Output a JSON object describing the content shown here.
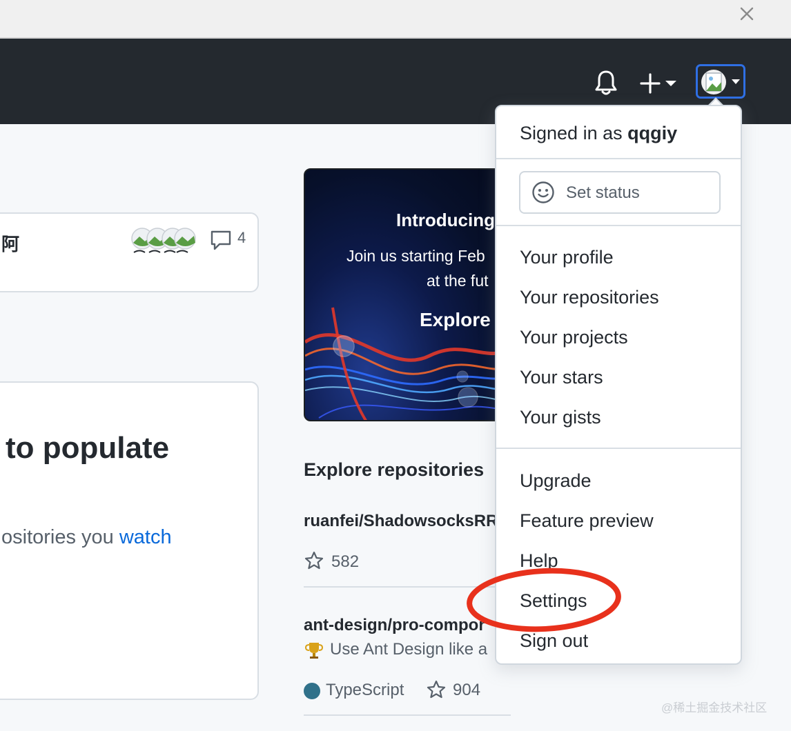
{
  "header": {
    "notifications_icon": "bell-icon",
    "create_icon": "plus-icon",
    "avatar_icon": "avatar-placeholder-icon"
  },
  "feed": {
    "card1_text": "阿",
    "card1_comment_count": "4",
    "card2_heading": "to populate",
    "card2_watch_prefix": "ositories you ",
    "card2_watch_link": "watch"
  },
  "promo": {
    "title": "Introducing",
    "subtitle_line1": "Join us starting Feb",
    "subtitle_line2": "at the fut",
    "cta": "Explore"
  },
  "explore": {
    "heading": "Explore repositories",
    "repos": [
      {
        "name": "ruanfei/ShadowsocksRR",
        "stars": "582"
      },
      {
        "name": "ant-design/pro-compor",
        "description": "Use Ant Design like a",
        "language": "TypeScript",
        "language_color": "#30718a",
        "stars": "904"
      }
    ]
  },
  "dropdown": {
    "signed_in_prefix": "Signed in as ",
    "username": "qqgiy",
    "set_status": "Set status",
    "items": [
      {
        "label": "Your profile"
      },
      {
        "label": "Your repositories"
      },
      {
        "label": "Your projects"
      },
      {
        "label": "Your stars"
      },
      {
        "label": "Your gists"
      },
      {
        "label": "Upgrade"
      },
      {
        "label": "Feature preview"
      },
      {
        "label": "Help"
      },
      {
        "label": "Settings"
      },
      {
        "label": "Sign out"
      }
    ]
  },
  "colors": {
    "header_bg": "#24292f",
    "link": "#0969da",
    "highlight": "#e8311c",
    "focus_ring": "#2f6fe4"
  },
  "watermark": "@稀土掘金技术社区"
}
